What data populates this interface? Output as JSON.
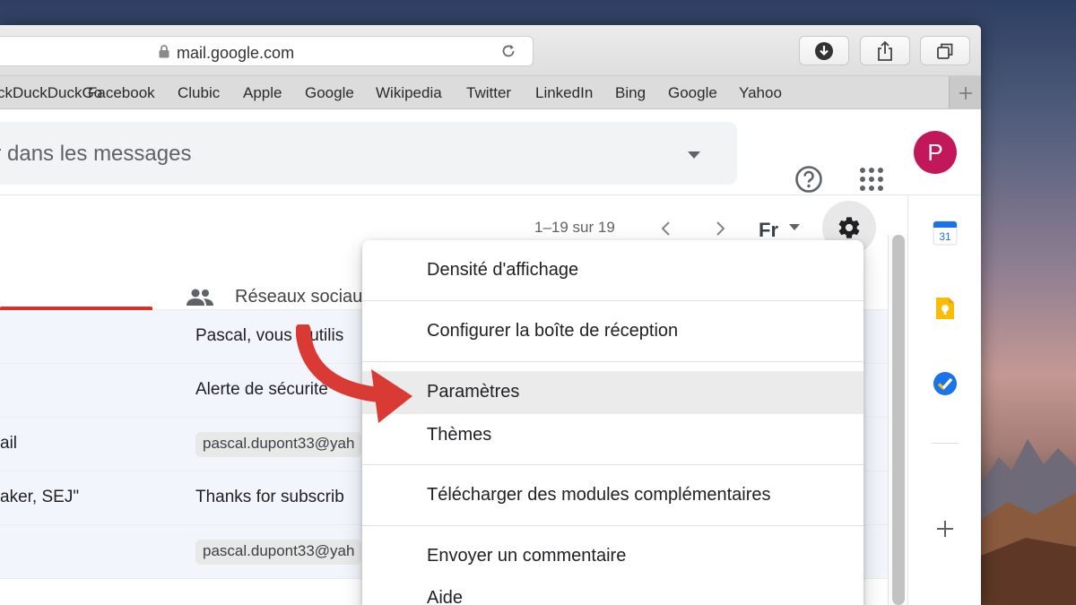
{
  "browser": {
    "url": "mail.google.com",
    "favorites": [
      "ckDuckDuckGo",
      "Facebook",
      "Clubic",
      "Apple",
      "Google",
      "Wikipedia",
      "Twitter",
      "LinkedIn",
      "Bing",
      "Google",
      "Yahoo"
    ]
  },
  "header": {
    "search_placeholder": "er dans les messages",
    "avatar_letter": "P",
    "avatar_color": "#c2185b"
  },
  "toolbar": {
    "pagination": "1–19 sur 19",
    "input_tools": "Fr"
  },
  "tabs": {
    "social_label": "Réseaux sociau"
  },
  "messages": [
    {
      "sender": "",
      "subject": "Pascal, vous n'utilis",
      "chip": ""
    },
    {
      "sender": "",
      "subject": "Alerte de sécurité -",
      "chip": ""
    },
    {
      "sender": "ail",
      "subject": "",
      "chip": "pascal.dupont33@yah"
    },
    {
      "sender": "aker, SEJ\"",
      "subject": "Thanks for subscrib",
      "chip": ""
    },
    {
      "sender": "",
      "subject": "",
      "chip": "pascal.dupont33@yah"
    }
  ],
  "settings_menu": {
    "items": [
      "Densité d'affichage",
      "Configurer la boîte de réception",
      "Paramètres",
      "Thèmes",
      "Télécharger des modules complémentaires",
      "Envoyer un commentaire",
      "Aide"
    ],
    "highlighted": "Paramètres"
  },
  "side_panel": {
    "calendar_day": "31"
  },
  "colors": {
    "accent_red": "#d93025",
    "arrow_red": "#d93a34"
  }
}
